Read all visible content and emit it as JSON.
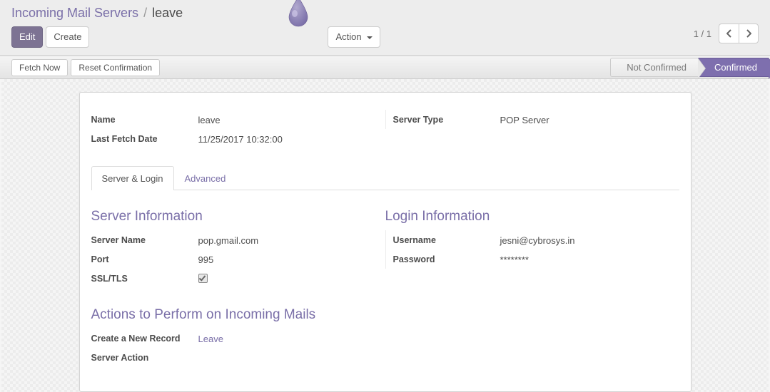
{
  "breadcrumb": {
    "root": "Incoming Mail Servers",
    "current": "leave"
  },
  "controls": {
    "edit": "Edit",
    "create": "Create",
    "action": "Action"
  },
  "pager": {
    "text": "1 / 1"
  },
  "statusbar": {
    "fetch_now": "Fetch Now",
    "reset_confirmation": "Reset Confirmation",
    "stages": {
      "not_confirmed": "Not Confirmed",
      "confirmed": "Confirmed"
    }
  },
  "fields": {
    "top": {
      "name_label": "Name",
      "name_value": "leave",
      "last_fetch_label": "Last Fetch Date",
      "last_fetch_value": "11/25/2017 10:32:00",
      "server_type_label": "Server Type",
      "server_type_value": "POP Server"
    }
  },
  "tabs": {
    "server_login": "Server & Login",
    "advanced": "Advanced"
  },
  "sections": {
    "server_info": {
      "title": "Server Information",
      "server_name_label": "Server Name",
      "server_name_value": "pop.gmail.com",
      "port_label": "Port",
      "port_value": "995",
      "ssl_label": "SSL/TLS",
      "ssl_value": true
    },
    "login_info": {
      "title": "Login Information",
      "username_label": "Username",
      "username_value": "jesni@cybrosys.in",
      "password_label": "Password",
      "password_value": "********"
    },
    "actions": {
      "title": "Actions to Perform on Incoming Mails",
      "create_record_label": "Create a New Record",
      "create_record_value": "Leave",
      "server_action_label": "Server Action",
      "server_action_value": ""
    }
  }
}
